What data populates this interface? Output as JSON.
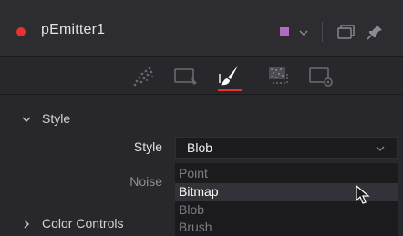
{
  "node": {
    "title": "pEmitter1",
    "status_color": "#e8322c",
    "swatch_color": "#b26bc4"
  },
  "tabs": [
    {
      "icon": "particles-icon",
      "active": false
    },
    {
      "icon": "region-icon",
      "active": false
    },
    {
      "icon": "brush-icon",
      "active": true
    },
    {
      "icon": "noise-texture-icon",
      "active": false
    },
    {
      "icon": "settings-icon",
      "active": false
    }
  ],
  "sections": {
    "style": {
      "label": "Style",
      "expanded": true
    },
    "color_controls": {
      "label": "Color Controls",
      "expanded": false
    }
  },
  "fields": {
    "style_label": "Style",
    "style_value": "Blob",
    "noise_label": "Noise"
  },
  "style_menu": {
    "options": [
      {
        "label": "Point",
        "state": "disabled"
      },
      {
        "label": "Bitmap",
        "state": "hover"
      },
      {
        "label": "Blob",
        "state": "disabled"
      },
      {
        "label": "Brush",
        "state": "disabled"
      }
    ]
  },
  "colors": {
    "accent_red": "#e8322c",
    "panel_bg": "#28282c",
    "field_bg": "#1b1b1e"
  }
}
